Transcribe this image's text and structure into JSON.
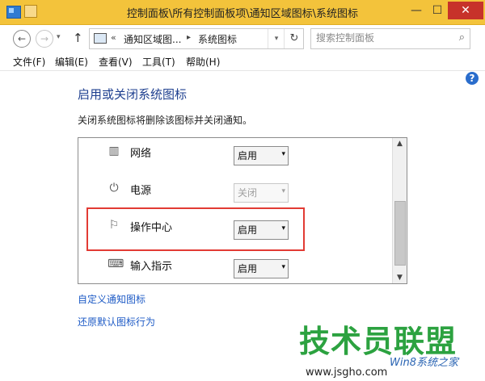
{
  "window": {
    "title": "控制面板\\所有控制面板项\\通知区域图标\\系统图标",
    "min_glyph": "—",
    "max_glyph": "☐",
    "close_glyph": "✕"
  },
  "nav": {
    "back_glyph": "←",
    "forward_glyph": "→",
    "recent_glyph": "▾",
    "up_glyph": "↑"
  },
  "address": {
    "more_glyph": "«",
    "crumbs": [
      "通知区域图...",
      "系统图标"
    ],
    "separator": "▸",
    "dropdown_glyph": "▾",
    "refresh_glyph": "↻"
  },
  "search": {
    "placeholder": "搜索控制面板",
    "icon_glyph": "⌕"
  },
  "menu": [
    "文件(F)",
    "编辑(E)",
    "查看(V)",
    "工具(T)",
    "帮助(H)"
  ],
  "content": {
    "help_glyph": "?",
    "title": "启用或关闭系统图标",
    "description": "关闭系统图标将删除该图标并关闭通知。",
    "rows": [
      {
        "label": "网络",
        "icon": "network-icon",
        "icon_glyph": "▥",
        "value": "启用",
        "disabled": false
      },
      {
        "label": "电源",
        "icon": "power-plug-icon",
        "icon_glyph": "⏻",
        "value": "关闭",
        "disabled": true
      },
      {
        "label": "操作中心",
        "icon": "flag-icon",
        "icon_glyph": "⚐",
        "value": "启用",
        "disabled": false
      },
      {
        "label": "输入指示",
        "icon": "keyboard-icon",
        "icon_glyph": "⌨",
        "value": "启用",
        "disabled": false
      }
    ],
    "select_arrow": "▾",
    "links": [
      "自定义通知图标",
      "还原默认图标行为"
    ]
  },
  "scrollbar": {
    "up_glyph": "▲",
    "down_glyph": "▼"
  },
  "watermark": {
    "brand": "技术员联盟",
    "sub": "Win8系统之家",
    "url": "www.jsgho.com"
  },
  "colors": {
    "titlebar": "#f3c33b",
    "title_text": "#1e3f8f",
    "link": "#1e5bc6",
    "highlight": "#e23b34"
  }
}
